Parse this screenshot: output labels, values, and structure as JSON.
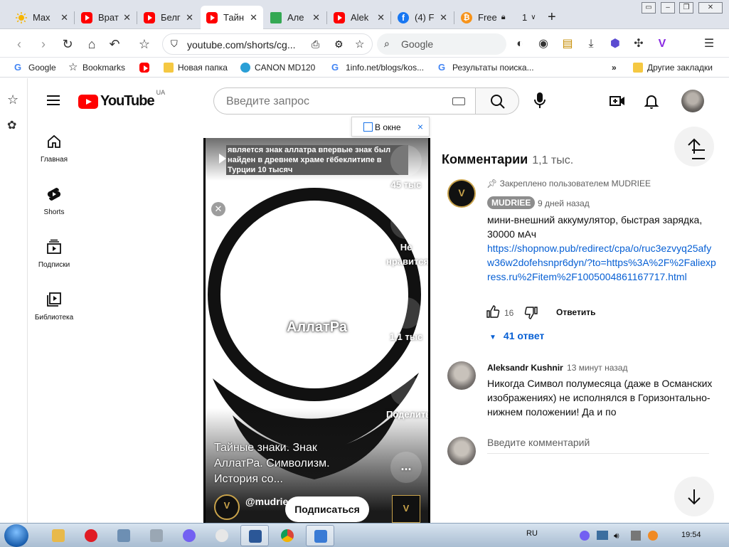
{
  "browser": {
    "tabs": [
      {
        "label": "Max",
        "icon": "sun-icon"
      },
      {
        "label": "Врат",
        "icon": "youtube-icon"
      },
      {
        "label": "Белг",
        "icon": "youtube-icon"
      },
      {
        "label": "Тайн",
        "icon": "youtube-icon",
        "active": true
      },
      {
        "label": "Але",
        "icon": "sheets-icon"
      },
      {
        "label": "Alek",
        "icon": "youtube-icon"
      },
      {
        "label": "(4) F",
        "icon": "facebook-icon"
      },
      {
        "label": "Free",
        "icon": "bitcoin-icon"
      }
    ],
    "tab_overflow_count": "1",
    "new_tab": "+",
    "address_url": "youtube.com/shorts/cg...",
    "search_engine_placeholder": "Google"
  },
  "bookmarks": [
    {
      "label": "Google",
      "icon": "google-icon"
    },
    {
      "label": "Bookmarks",
      "icon": "star-icon"
    },
    {
      "label": "",
      "icon": "youtube-icon"
    },
    {
      "label": "Новая папка",
      "icon": "folder-icon"
    },
    {
      "label": "CANON MD120",
      "icon": "canon-icon"
    },
    {
      "label": "1info.net/blogs/kos...",
      "icon": "google-icon"
    },
    {
      "label": "Результаты поиска...",
      "icon": "google-icon"
    }
  ],
  "bookmarks_overflow": "»",
  "other_bookmarks": "Другие закладки",
  "youtube": {
    "logo_text": "YouTube",
    "country_code": "UA",
    "search_placeholder": "Введите запрос",
    "nav": [
      {
        "label": "Главная",
        "icon": "home-icon"
      },
      {
        "label": "Shorts",
        "icon": "shorts-icon"
      },
      {
        "label": "Подписки",
        "icon": "subscriptions-icon"
      },
      {
        "label": "Библиотека",
        "icon": "library-icon"
      }
    ]
  },
  "popout": {
    "label": "В окне",
    "close": "×"
  },
  "short": {
    "caption": "является знак аллатра впервые знак был найден в древнем храме гёбеклитипе в Турции 10 тысяч",
    "center_title": "АллатРа",
    "likes": "45 тыс",
    "dislike_label": "Не нравится",
    "comments_count": "1,1 тыс",
    "share_label": "Поделиться",
    "more_label": "...",
    "title": "Тайные знаки. Знак АллатРа. Символизм. История со...",
    "channel_handle": "@mudriee",
    "subscribe_label": "Подписаться"
  },
  "comments": {
    "heading": "Комментарии",
    "count": "1,1 тыс.",
    "pinned_label": "Закреплено пользователем MUDRIEE",
    "first": {
      "author": "MUDRIEE",
      "time": "9 дней назад",
      "text": "мини-внешний аккумулятор, быстрая зарядка, 30000 мАч",
      "link": "https://shopnow.pub/redirect/cpa/o/ruc3ezvyq25afyw36w2dofehsnpr6dyn/?to=https%3A%2F%2Faliexpress.ru%2Fitem%2F1005004861167717.html",
      "likes": "16",
      "reply_label": "Ответить",
      "replies_label": "41 ответ"
    },
    "second": {
      "author": "Aleksandr Kushnir",
      "time": "13 минут назад",
      "text": "Никогда Символ полумесяца (даже в Османских изображениях) не исполнялся в Горизонтально-нижнем положении! Да и по"
    },
    "add_placeholder": "Введите комментарий"
  },
  "taskbar": {
    "language": "RU",
    "clock": "19:54"
  },
  "colors": {
    "youtube_red": "#ff0000",
    "link_blue": "#065fd4",
    "gold": "#c8a24a"
  }
}
